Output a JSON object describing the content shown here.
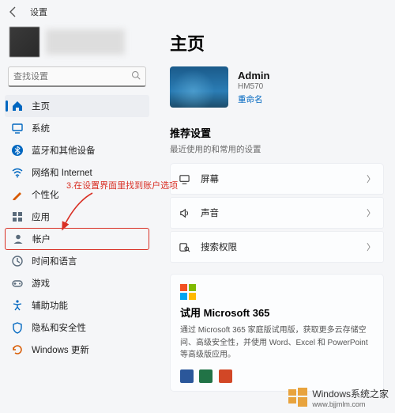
{
  "header": {
    "title": "设置"
  },
  "search": {
    "placeholder": "查找设置"
  },
  "sidebar": {
    "items": [
      {
        "label": "主页",
        "icon": "home",
        "color": "#0067c0",
        "active": true
      },
      {
        "label": "系统",
        "icon": "system",
        "color": "#0067c0"
      },
      {
        "label": "蓝牙和其他设备",
        "icon": "bluetooth",
        "color": "#0067c0"
      },
      {
        "label": "网络和 Internet",
        "icon": "wifi",
        "color": "#0067c0"
      },
      {
        "label": "个性化",
        "icon": "personalize",
        "color": "#d85a00"
      },
      {
        "label": "应用",
        "icon": "apps",
        "color": "#5a6b7b"
      },
      {
        "label": "帐户",
        "icon": "account",
        "color": "#5a6b7b",
        "highlighted": true
      },
      {
        "label": "时间和语言",
        "icon": "time",
        "color": "#5a6b7b"
      },
      {
        "label": "游戏",
        "icon": "gaming",
        "color": "#5a6b7b"
      },
      {
        "label": "辅助功能",
        "icon": "accessibility",
        "color": "#0067c0"
      },
      {
        "label": "隐私和安全性",
        "icon": "privacy",
        "color": "#0067c0"
      },
      {
        "label": "Windows 更新",
        "icon": "update",
        "color": "#d85a00"
      }
    ]
  },
  "main": {
    "title": "主页",
    "account": {
      "name": "Admin",
      "device": "HM570",
      "rename": "重命名"
    },
    "recommended": {
      "title": "推荐设置",
      "subtitle": "最近使用的和常用的设置"
    },
    "settings": [
      {
        "label": "屏幕",
        "icon": "display"
      },
      {
        "label": "声音",
        "icon": "sound"
      },
      {
        "label": "搜索权限",
        "icon": "search-perm"
      }
    ],
    "promo": {
      "title": "试用 Microsoft 365",
      "desc": "通过 Microsoft 365 家庭版试用版，获取更多云存储空间、高级安全性，并使用 Word、Excel 和 PowerPoint 等高级版应用。"
    }
  },
  "annotation": {
    "text": "3.在设置界面里找到账户选项"
  },
  "watermark": {
    "title": "Windows系统之家",
    "url": "www.bjjmlm.com"
  }
}
